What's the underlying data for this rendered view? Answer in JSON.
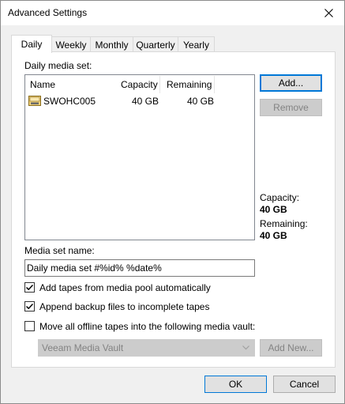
{
  "window": {
    "title": "Advanced Settings"
  },
  "tabs": [
    {
      "label": "Daily",
      "active": true
    },
    {
      "label": "Weekly",
      "active": false
    },
    {
      "label": "Monthly",
      "active": false
    },
    {
      "label": "Quarterly",
      "active": false
    },
    {
      "label": "Yearly",
      "active": false
    }
  ],
  "media_set": {
    "label": "Daily media set:",
    "columns": [
      "Name",
      "Capacity",
      "Remaining"
    ],
    "rows": [
      {
        "icon": "tape-icon",
        "name": "SWOHC005",
        "capacity": "40 GB",
        "remaining": "40 GB"
      }
    ]
  },
  "buttons": {
    "add": "Add...",
    "remove": "Remove",
    "add_new": "Add New...",
    "ok": "OK",
    "cancel": "Cancel"
  },
  "info": {
    "capacity_label": "Capacity:",
    "capacity_value": "40 GB",
    "remaining_label": "Remaining:",
    "remaining_value": "40 GB"
  },
  "media_set_name": {
    "label": "Media set name:",
    "value": "Daily media set #%id% %date%"
  },
  "options": [
    {
      "label": "Add tapes from media pool automatically",
      "checked": true
    },
    {
      "label": "Append backup files to incomplete tapes",
      "checked": true
    },
    {
      "label": "Move all offline tapes into the following media vault:",
      "checked": false
    }
  ],
  "vault_select": {
    "value": "Veeam Media Vault",
    "disabled": true
  },
  "colors": {
    "accent": "#0078d7",
    "disabled_bg": "#cccccc",
    "disabled_text": "#838383"
  }
}
